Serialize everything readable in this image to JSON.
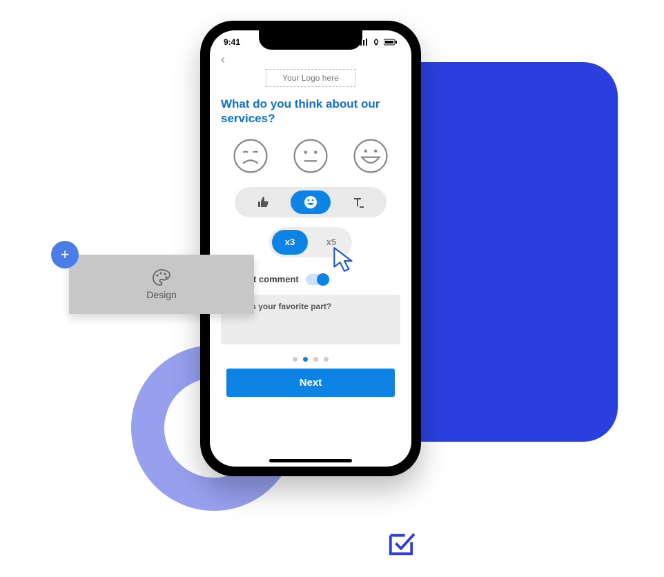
{
  "status": {
    "time": "9:41"
  },
  "logo_placeholder": "Your Logo here",
  "question": "What do you think about our services?",
  "selector": {
    "options": [
      "thumbs",
      "smiley",
      "text"
    ],
    "active": "smiley"
  },
  "scale": {
    "options": [
      "x3",
      "x5"
    ],
    "active": "x3"
  },
  "toggle": {
    "label": "Request comment",
    "on": true
  },
  "comment_placeholder": "What's your favorite part?",
  "next_label": "Next",
  "pager": {
    "count": 4,
    "active_index": 1
  },
  "design_card": {
    "label": "Design"
  }
}
